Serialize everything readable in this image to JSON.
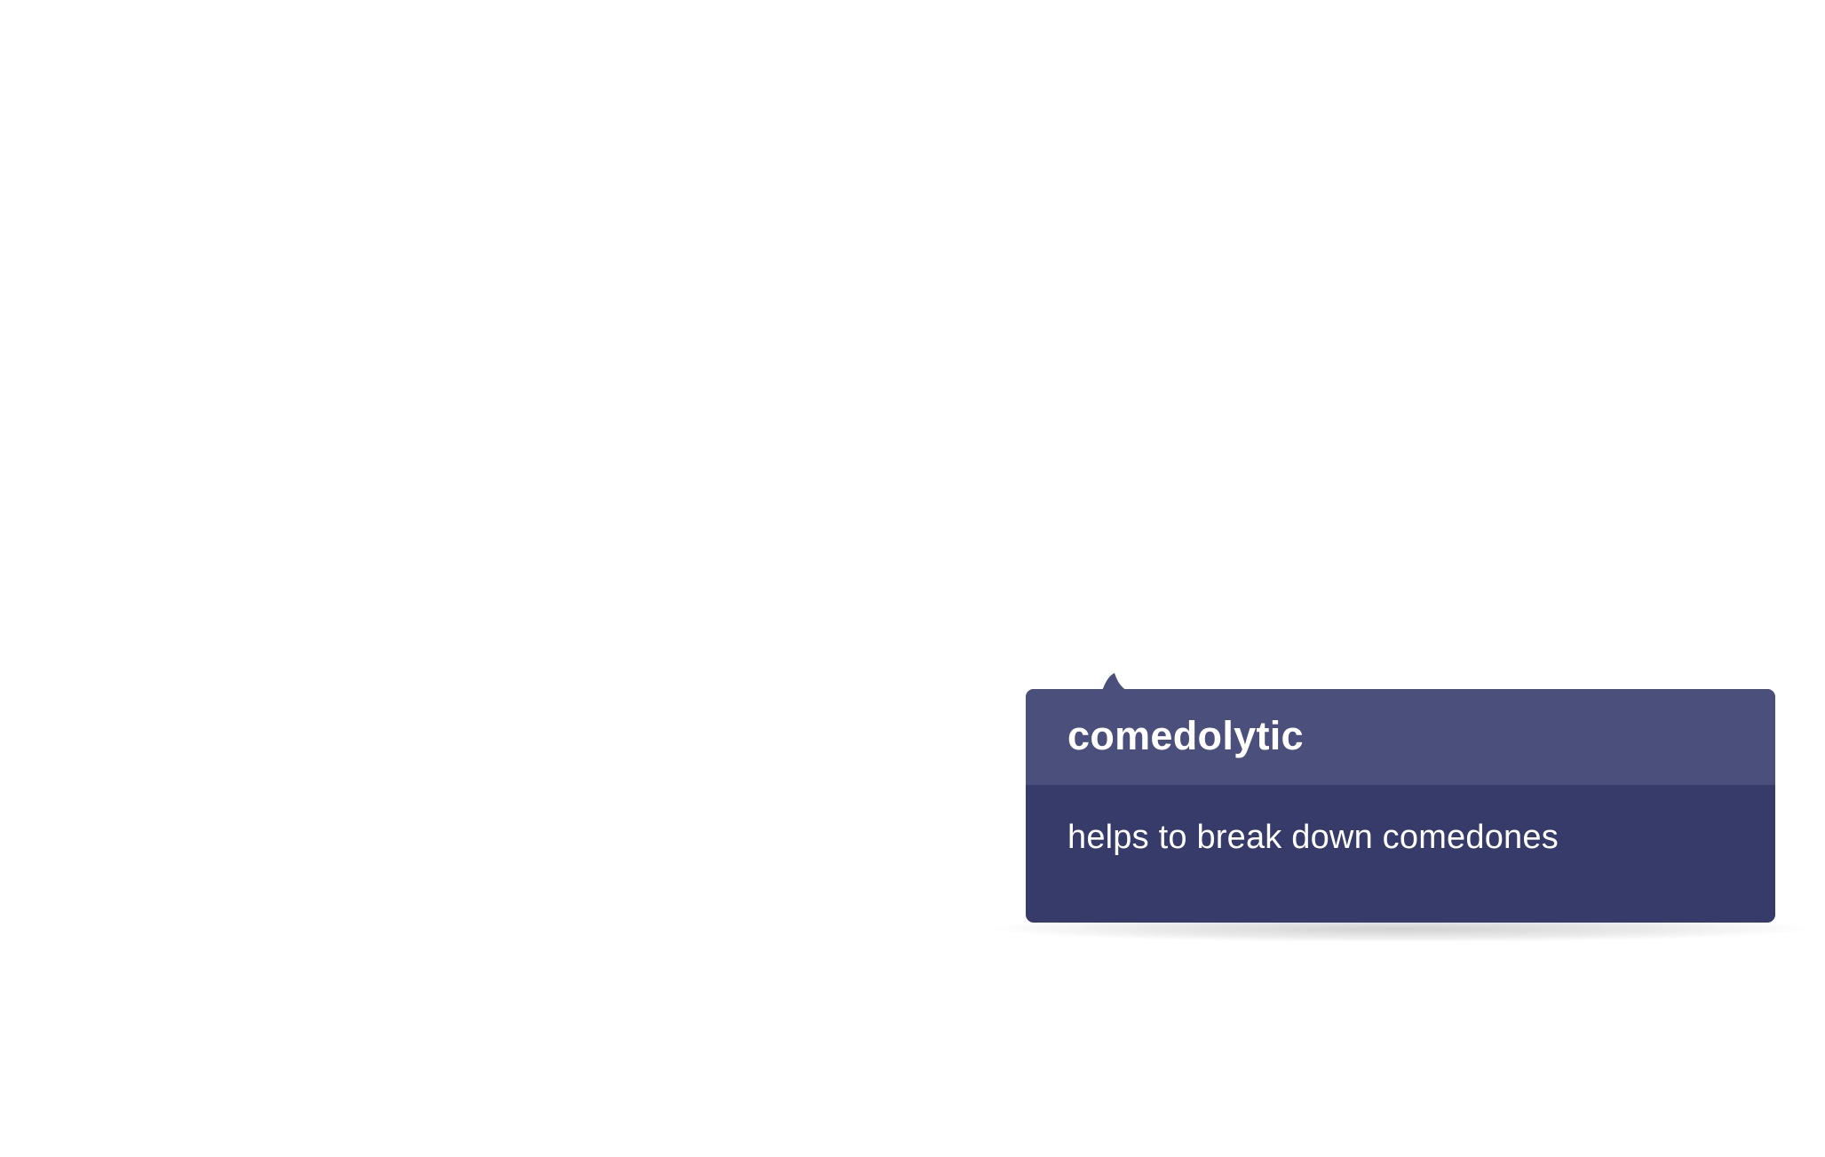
{
  "tooltip": {
    "term": "comedolytic",
    "definition": "helps to break down comedones"
  },
  "colors": {
    "header_bg": "#4a4f7b",
    "body_bg": "#363b6a",
    "text": "#ffffff",
    "page_bg": "#ffffff"
  }
}
